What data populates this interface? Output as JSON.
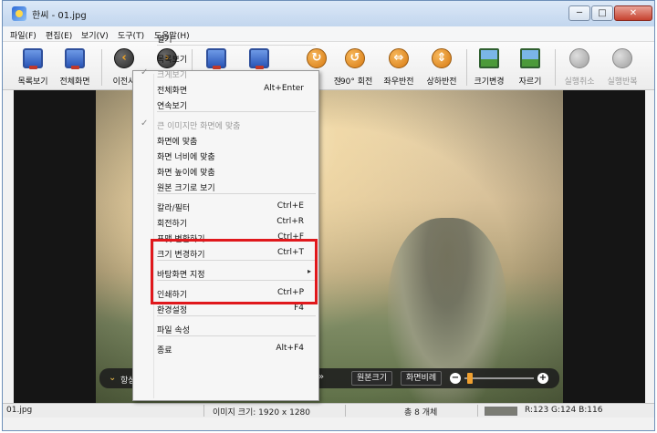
{
  "window": {
    "title": "한씨 - 01.jpg",
    "min_label": "─",
    "max_label": "□",
    "close_label": "✕"
  },
  "menubar": [
    "파일(F)",
    "편집(E)",
    "보기(V)",
    "도구(T)",
    "도움말(H)"
  ],
  "toolbar": [
    {
      "label": "목록보기",
      "icon": "list-view-icon"
    },
    {
      "label": "전체화면",
      "icon": "fullscreen-icon"
    },
    {
      "label": "이전사",
      "icon": "previous-arrow-icon"
    },
    {
      "label": "",
      "icon": "next-arrow-icon"
    },
    {
      "label": "",
      "icon": "print-icon"
    },
    {
      "label": "",
      "icon": "save-icon"
    },
    {
      "label": "전",
      "icon": "rotate-icon"
    },
    {
      "label": "-90° 회전",
      "icon": "rotate-left-icon"
    },
    {
      "label": "좌우반전",
      "icon": "flip-horizontal-icon"
    },
    {
      "label": "상하반전",
      "icon": "flip-vertical-icon"
    },
    {
      "label": "크기변경",
      "icon": "resize-icon"
    },
    {
      "label": "자르기",
      "icon": "crop-icon"
    },
    {
      "label": "실행취소",
      "icon": "undo-icon"
    },
    {
      "label": "실행반복",
      "icon": "redo-icon"
    }
  ],
  "context_menu": {
    "items": [
      {
        "label": "열기",
        "shortcut": ""
      },
      {
        "label": "목록보기",
        "shortcut": ""
      },
      {
        "label": "크게보기",
        "shortcut": "",
        "checked": true,
        "disabled": true
      },
      {
        "label": "전체화면",
        "shortcut": "Alt+Enter"
      },
      {
        "label": "연속보기",
        "shortcut": ""
      },
      {
        "label": "큰 이미지만 화면에 맞춤",
        "shortcut": "",
        "checked": true,
        "disabled": true
      },
      {
        "label": "화면에 맞춤",
        "shortcut": ""
      },
      {
        "label": "화면 너비에 맞춤",
        "shortcut": ""
      },
      {
        "label": "화면 높이에 맞춤",
        "shortcut": ""
      },
      {
        "label": "원본 크기로 보기",
        "shortcut": ""
      },
      {
        "label": "칼라/필터",
        "shortcut": "Ctrl+E"
      },
      {
        "label": "회전하기",
        "shortcut": "Ctrl+R"
      },
      {
        "label": "포맷 변환하기",
        "shortcut": "Ctrl+F"
      },
      {
        "label": "크기 변경하기",
        "shortcut": "Ctrl+T"
      },
      {
        "label": "바탕화면 지정",
        "shortcut": "",
        "submenu": true
      },
      {
        "label": "인쇄하기",
        "shortcut": "Ctrl+P"
      },
      {
        "label": "환경설정",
        "shortcut": "F4"
      },
      {
        "label": "파일 속성",
        "shortcut": ""
      },
      {
        "label": "종료",
        "shortcut": "Alt+F4"
      }
    ],
    "checkmark": "✓",
    "submenu_arrow": "▸"
  },
  "viewer_controls": {
    "always_label": "항상",
    "next_label": "»",
    "original_size_button": "원본크기",
    "fit_screen_button": "화면비례",
    "zoom_out": "−",
    "zoom_in": "+"
  },
  "statusbar": {
    "filename": "01.jpg",
    "image_size": "이미지 크기: 1920 x 1280",
    "count": "총 8 개체",
    "rgb": "R:123 G:124 B:116",
    "pixel_color": "#7b7c74"
  },
  "colors": {
    "highlight_border": "#e0181c"
  }
}
